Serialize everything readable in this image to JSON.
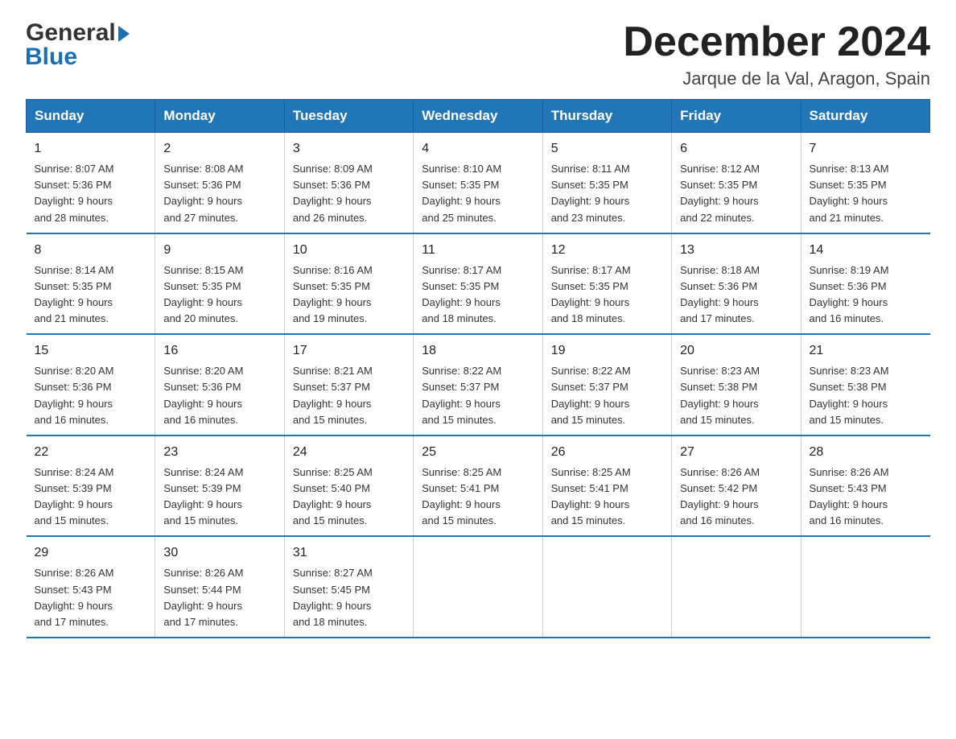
{
  "logo": {
    "general": "General",
    "blue": "Blue"
  },
  "header": {
    "month": "December 2024",
    "location": "Jarque de la Val, Aragon, Spain"
  },
  "weekdays": [
    "Sunday",
    "Monday",
    "Tuesday",
    "Wednesday",
    "Thursday",
    "Friday",
    "Saturday"
  ],
  "weeks": [
    [
      {
        "day": "1",
        "sunrise": "8:07 AM",
        "sunset": "5:36 PM",
        "daylight_hours": "9",
        "daylight_minutes": "28"
      },
      {
        "day": "2",
        "sunrise": "8:08 AM",
        "sunset": "5:36 PM",
        "daylight_hours": "9",
        "daylight_minutes": "27"
      },
      {
        "day": "3",
        "sunrise": "8:09 AM",
        "sunset": "5:36 PM",
        "daylight_hours": "9",
        "daylight_minutes": "26"
      },
      {
        "day": "4",
        "sunrise": "8:10 AM",
        "sunset": "5:35 PM",
        "daylight_hours": "9",
        "daylight_minutes": "25"
      },
      {
        "day": "5",
        "sunrise": "8:11 AM",
        "sunset": "5:35 PM",
        "daylight_hours": "9",
        "daylight_minutes": "23"
      },
      {
        "day": "6",
        "sunrise": "8:12 AM",
        "sunset": "5:35 PM",
        "daylight_hours": "9",
        "daylight_minutes": "22"
      },
      {
        "day": "7",
        "sunrise": "8:13 AM",
        "sunset": "5:35 PM",
        "daylight_hours": "9",
        "daylight_minutes": "21"
      }
    ],
    [
      {
        "day": "8",
        "sunrise": "8:14 AM",
        "sunset": "5:35 PM",
        "daylight_hours": "9",
        "daylight_minutes": "21"
      },
      {
        "day": "9",
        "sunrise": "8:15 AM",
        "sunset": "5:35 PM",
        "daylight_hours": "9",
        "daylight_minutes": "20"
      },
      {
        "day": "10",
        "sunrise": "8:16 AM",
        "sunset": "5:35 PM",
        "daylight_hours": "9",
        "daylight_minutes": "19"
      },
      {
        "day": "11",
        "sunrise": "8:17 AM",
        "sunset": "5:35 PM",
        "daylight_hours": "9",
        "daylight_minutes": "18"
      },
      {
        "day": "12",
        "sunrise": "8:17 AM",
        "sunset": "5:35 PM",
        "daylight_hours": "9",
        "daylight_minutes": "18"
      },
      {
        "day": "13",
        "sunrise": "8:18 AM",
        "sunset": "5:36 PM",
        "daylight_hours": "9",
        "daylight_minutes": "17"
      },
      {
        "day": "14",
        "sunrise": "8:19 AM",
        "sunset": "5:36 PM",
        "daylight_hours": "9",
        "daylight_minutes": "16"
      }
    ],
    [
      {
        "day": "15",
        "sunrise": "8:20 AM",
        "sunset": "5:36 PM",
        "daylight_hours": "9",
        "daylight_minutes": "16"
      },
      {
        "day": "16",
        "sunrise": "8:20 AM",
        "sunset": "5:36 PM",
        "daylight_hours": "9",
        "daylight_minutes": "16"
      },
      {
        "day": "17",
        "sunrise": "8:21 AM",
        "sunset": "5:37 PM",
        "daylight_hours": "9",
        "daylight_minutes": "15"
      },
      {
        "day": "18",
        "sunrise": "8:22 AM",
        "sunset": "5:37 PM",
        "daylight_hours": "9",
        "daylight_minutes": "15"
      },
      {
        "day": "19",
        "sunrise": "8:22 AM",
        "sunset": "5:37 PM",
        "daylight_hours": "9",
        "daylight_minutes": "15"
      },
      {
        "day": "20",
        "sunrise": "8:23 AM",
        "sunset": "5:38 PM",
        "daylight_hours": "9",
        "daylight_minutes": "15"
      },
      {
        "day": "21",
        "sunrise": "8:23 AM",
        "sunset": "5:38 PM",
        "daylight_hours": "9",
        "daylight_minutes": "15"
      }
    ],
    [
      {
        "day": "22",
        "sunrise": "8:24 AM",
        "sunset": "5:39 PM",
        "daylight_hours": "9",
        "daylight_minutes": "15"
      },
      {
        "day": "23",
        "sunrise": "8:24 AM",
        "sunset": "5:39 PM",
        "daylight_hours": "9",
        "daylight_minutes": "15"
      },
      {
        "day": "24",
        "sunrise": "8:25 AM",
        "sunset": "5:40 PM",
        "daylight_hours": "9",
        "daylight_minutes": "15"
      },
      {
        "day": "25",
        "sunrise": "8:25 AM",
        "sunset": "5:41 PM",
        "daylight_hours": "9",
        "daylight_minutes": "15"
      },
      {
        "day": "26",
        "sunrise": "8:25 AM",
        "sunset": "5:41 PM",
        "daylight_hours": "9",
        "daylight_minutes": "15"
      },
      {
        "day": "27",
        "sunrise": "8:26 AM",
        "sunset": "5:42 PM",
        "daylight_hours": "9",
        "daylight_minutes": "16"
      },
      {
        "day": "28",
        "sunrise": "8:26 AM",
        "sunset": "5:43 PM",
        "daylight_hours": "9",
        "daylight_minutes": "16"
      }
    ],
    [
      {
        "day": "29",
        "sunrise": "8:26 AM",
        "sunset": "5:43 PM",
        "daylight_hours": "9",
        "daylight_minutes": "17"
      },
      {
        "day": "30",
        "sunrise": "8:26 AM",
        "sunset": "5:44 PM",
        "daylight_hours": "9",
        "daylight_minutes": "17"
      },
      {
        "day": "31",
        "sunrise": "8:27 AM",
        "sunset": "5:45 PM",
        "daylight_hours": "9",
        "daylight_minutes": "18"
      },
      {
        "day": "",
        "sunrise": "",
        "sunset": "",
        "daylight_hours": "",
        "daylight_minutes": ""
      },
      {
        "day": "",
        "sunrise": "",
        "sunset": "",
        "daylight_hours": "",
        "daylight_minutes": ""
      },
      {
        "day": "",
        "sunrise": "",
        "sunset": "",
        "daylight_hours": "",
        "daylight_minutes": ""
      },
      {
        "day": "",
        "sunrise": "",
        "sunset": "",
        "daylight_hours": "",
        "daylight_minutes": ""
      }
    ]
  ],
  "labels": {
    "sunrise": "Sunrise:",
    "sunset": "Sunset:",
    "daylight": "Daylight: ",
    "hours": " hours",
    "and": "and ",
    "minutes": " minutes."
  }
}
